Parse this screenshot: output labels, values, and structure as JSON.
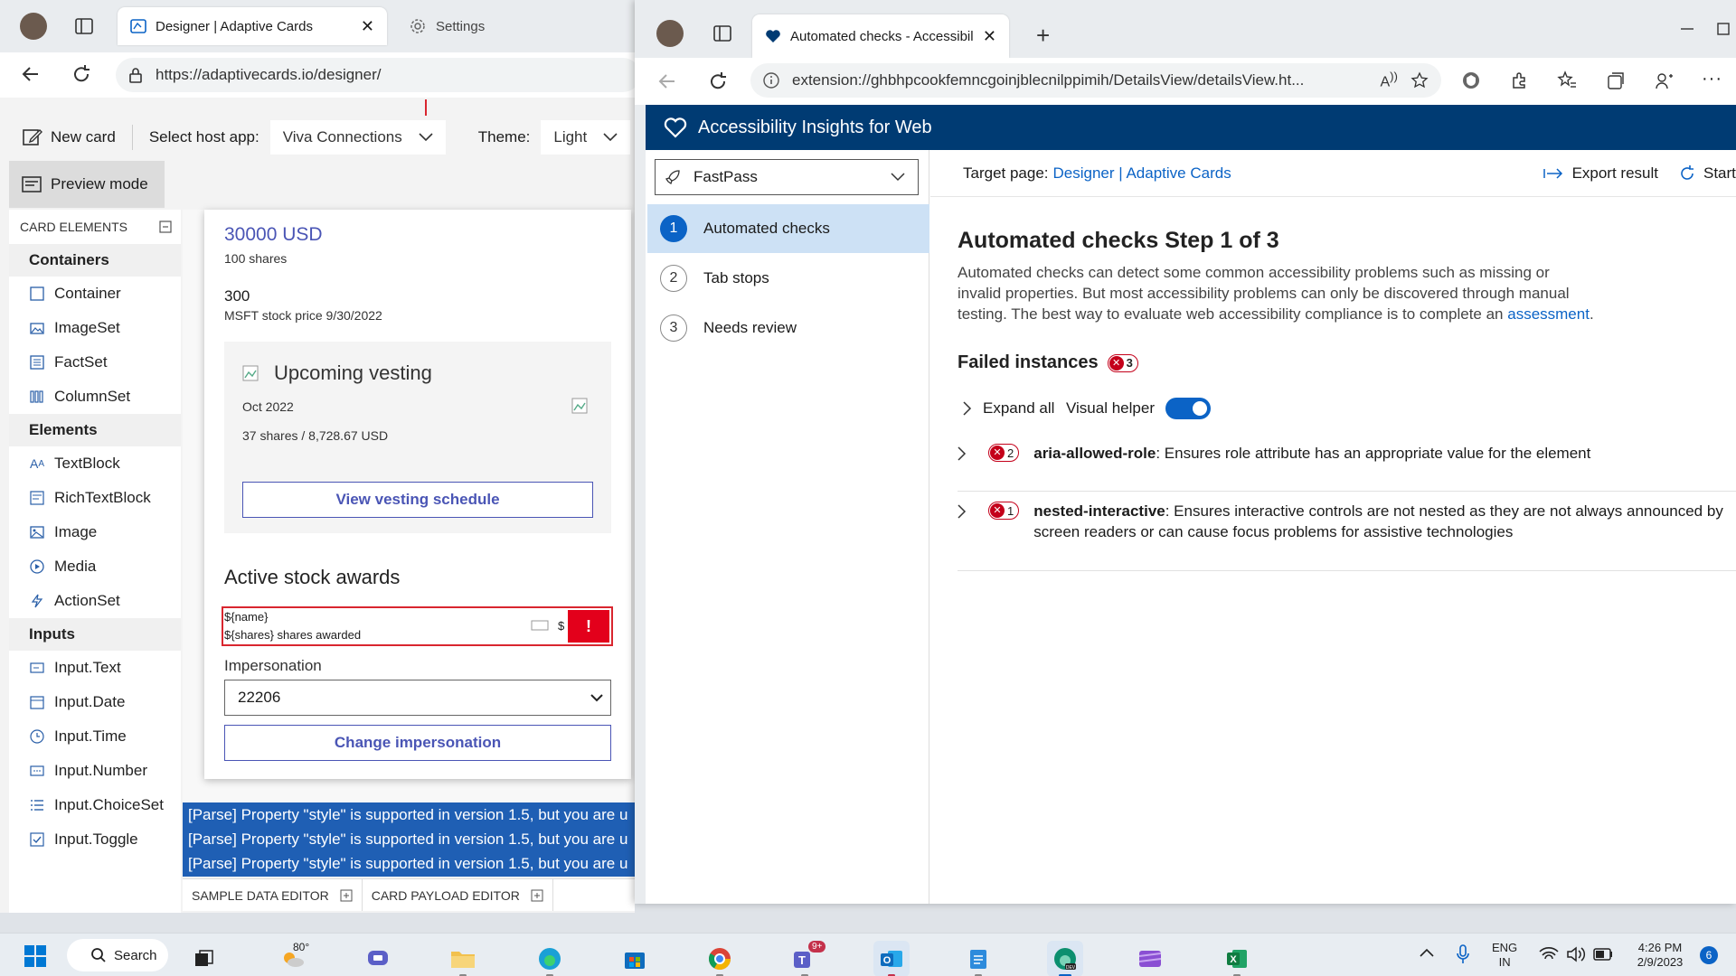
{
  "left_browser": {
    "tabs": [
      {
        "label": "Designer | Adaptive Cards",
        "active": true
      },
      {
        "label": "Settings",
        "active": false
      }
    ],
    "address": "https://adaptivecards.io/designer/"
  },
  "designer": {
    "toolbar": {
      "new_card": "New card",
      "host_label": "Select host app:",
      "host_value": "Viva Connections",
      "theme_label": "Theme:",
      "theme_value": "Light",
      "preview_mode": "Preview mode"
    },
    "palette": {
      "header": "CARD ELEMENTS",
      "categories": [
        {
          "name": "Containers",
          "items": [
            "Container",
            "ImageSet",
            "FactSet",
            "ColumnSet"
          ]
        },
        {
          "name": "Elements",
          "items": [
            "TextBlock",
            "RichTextBlock",
            "Image",
            "Media",
            "ActionSet"
          ]
        },
        {
          "name": "Inputs",
          "items": [
            "Input.Text",
            "Input.Date",
            "Input.Time",
            "Input.Number",
            "Input.ChoiceSet",
            "Input.Toggle"
          ]
        }
      ]
    },
    "card": {
      "amount": "30000 USD",
      "shares": "100 shares",
      "price": "300",
      "price_caption": "MSFT stock price 9/30/2022",
      "vesting_title": "Upcoming vesting",
      "vesting_date": "Oct 2022",
      "vesting_detail": "37 shares / 8,728.67 USD",
      "vesting_button": "View vesting schedule",
      "awards_title": "Active stock awards",
      "template_name": "${name}",
      "template_shares": "${shares} shares awarded",
      "template_dollar": "$",
      "error_mark": "!",
      "impersonation_label": "Impersonation",
      "impersonation_value": "22206",
      "change_button": "Change impersonation"
    },
    "console": [
      "[Parse] Property \"style\" is supported in version 1.5, but you are u",
      "[Parse] Property \"style\" is supported in version 1.5, but you are u",
      "[Parse] Property \"style\" is supported in version 1.5, but you are u"
    ],
    "bottom_tabs": [
      "SAMPLE DATA EDITOR",
      "CARD PAYLOAD EDITOR"
    ]
  },
  "right_browser": {
    "tab_title": "Automated checks - Accessibil",
    "address": "extension://ghbhpcookfemncgoinjblecnilppimih/DetailsView/detailsView.ht..."
  },
  "insights": {
    "app_title": "Accessibility Insights for Web",
    "mode": "FastPass",
    "nav": [
      {
        "num": "1",
        "label": "Automated checks",
        "selected": true
      },
      {
        "num": "2",
        "label": "Tab stops",
        "selected": false
      },
      {
        "num": "3",
        "label": "Needs review",
        "selected": false
      }
    ],
    "target_label": "Target page:",
    "target_link": "Designer | Adaptive Cards",
    "export": "Export result",
    "start_over": "Start",
    "heading": "Automated checks Step 1 of 3",
    "description_1": "Automated checks can detect some common accessibility problems such as missing or",
    "description_2": "invalid properties. But most accessibility problems can only be discovered through manual",
    "description_3": "testing. The best way to evaluate web accessibility compliance is to complete an",
    "assessment_link": "assessment",
    "description_end": ".",
    "failed_title": "Failed instances",
    "failed_count": "3",
    "expand_all": "Expand all",
    "visual_helper": "Visual helper",
    "rules": [
      {
        "count": "2",
        "name": "aria-allowed-role",
        "desc_1": ": Ensures role attribute has an appropriate value for the element",
        "desc_2": ""
      },
      {
        "count": "1",
        "name": "nested-interactive",
        "desc_1": ": Ensures interactive controls are not nested as they are not always announced by",
        "desc_2": "screen readers or can cause focus problems for assistive technologies"
      }
    ]
  },
  "taskbar": {
    "search": "Search",
    "weather": "80°",
    "teams_badge": "9+",
    "lang_1": "ENG",
    "lang_2": "IN",
    "time": "4:26 PM",
    "date": "2/9/2023",
    "notifications": "6"
  },
  "colors": {
    "insights_header": "#003b73",
    "accent": "#0b63c6",
    "error": "#c4001a",
    "card_link": "#4a55b5",
    "console": "#1f5fb4"
  }
}
